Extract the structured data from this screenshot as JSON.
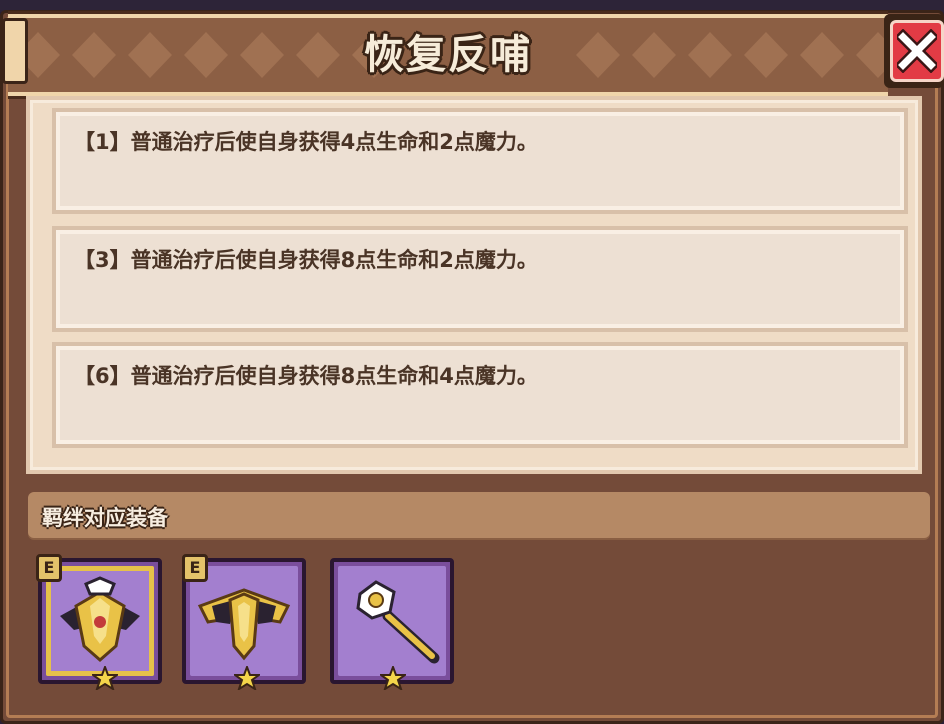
{
  "dialog": {
    "title": "恢复反哺",
    "close_icon": "close-icon"
  },
  "effects": [
    {
      "text": "【1】普通治疗后使自身获得4点生命和2点魔力。"
    },
    {
      "text": "【3】普通治疗后使自身获得8点生命和2点魔力。"
    },
    {
      "text": "【6】普通治疗后使自身获得8点生命和4点魔力。"
    }
  ],
  "equipment": {
    "label": "羁绊对应装备",
    "items": [
      {
        "icon": "golden-armor-icon",
        "badge": "E",
        "rarity_stars": 1
      },
      {
        "icon": "winged-armor-icon",
        "badge": "E",
        "rarity_stars": 1
      },
      {
        "icon": "scepter-icon",
        "rarity_stars": 1
      }
    ]
  },
  "colors": {
    "panel_bg": "#744b39",
    "card_bg": "#ede0d3",
    "close_red": "#e23b45",
    "slot_purple": "#a37fcf"
  }
}
